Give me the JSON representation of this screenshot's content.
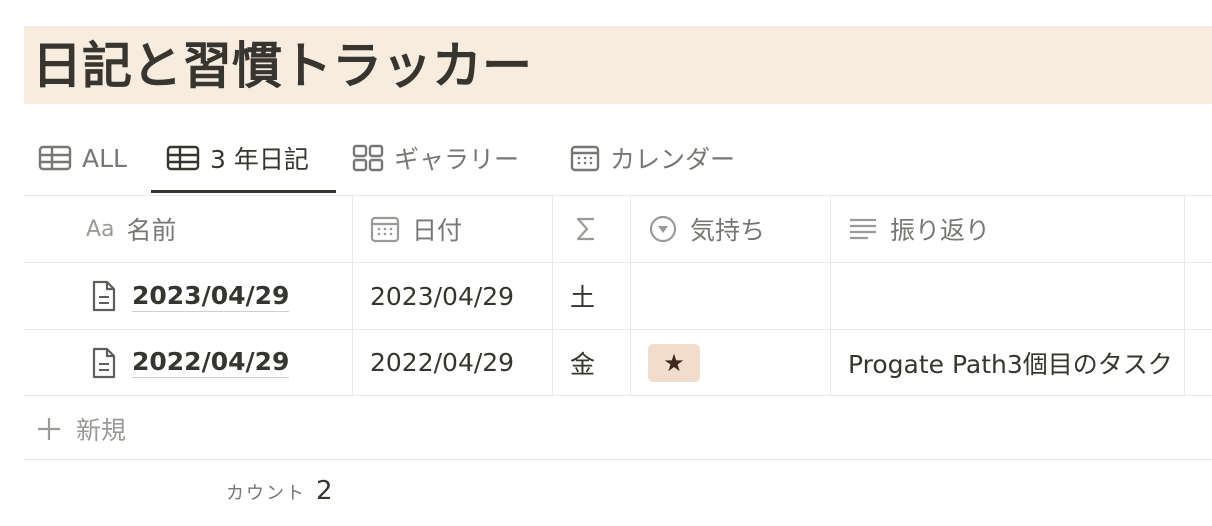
{
  "page": {
    "title": "日記と習慣トラッカー"
  },
  "tabs": [
    {
      "label": "ALL",
      "icon": "table-icon"
    },
    {
      "label": "3 年日記",
      "icon": "table-icon",
      "active": true
    },
    {
      "label": "ギャラリー",
      "icon": "gallery-grid-icon"
    },
    {
      "label": "カレンダー",
      "icon": "calendar-icon"
    }
  ],
  "table": {
    "columns": [
      {
        "label": "名前",
        "icon_text": "Aa",
        "icon": "title-property-icon"
      },
      {
        "label": "日付",
        "icon": "calendar-property-icon"
      },
      {
        "label": "",
        "icon": "sigma-formula-icon"
      },
      {
        "label": "気持ち",
        "icon": "select-property-icon"
      },
      {
        "label": "振り返り",
        "icon": "text-lines-icon"
      }
    ],
    "rows": [
      {
        "name": "2023/04/29",
        "date": "2023/04/29",
        "weekday": "土",
        "mood": "",
        "reflection": ""
      },
      {
        "name": "2022/04/29",
        "date": "2022/04/29",
        "weekday": "金",
        "mood": "★",
        "reflection": "Progate Path3個目のタスク"
      }
    ],
    "new_label": "新規",
    "count_label": "カウント",
    "count_value": "2"
  },
  "colors": {
    "title_background": "#f8ecdf",
    "text": "#37352f",
    "muted": "#787774",
    "mood_badge": "#f2dccb"
  }
}
